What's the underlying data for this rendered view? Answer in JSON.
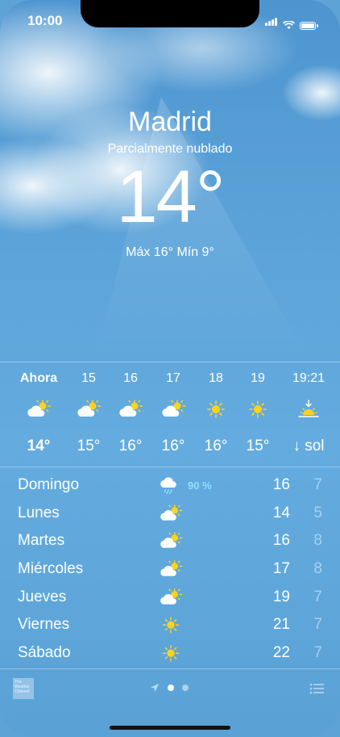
{
  "status_bar": {
    "time": "10:00"
  },
  "current": {
    "city": "Madrid",
    "condition": "Parcialmente nublado",
    "temperature": "14°",
    "hilo": "Máx 16°  Mín 9°"
  },
  "hourly": [
    {
      "label": "Ahora",
      "icon": "partly-cloudy-icon",
      "temp": "14°"
    },
    {
      "label": "15",
      "icon": "partly-cloudy-icon",
      "temp": "15°"
    },
    {
      "label": "16",
      "icon": "partly-cloudy-icon",
      "temp": "16°"
    },
    {
      "label": "17",
      "icon": "partly-cloudy-icon",
      "temp": "16°"
    },
    {
      "label": "18",
      "icon": "sun-icon",
      "temp": "16°"
    },
    {
      "label": "19",
      "icon": "sun-icon",
      "temp": "15°"
    },
    {
      "label": "19:21",
      "icon": "sunset-icon",
      "temp": "↓ sol"
    }
  ],
  "daily": [
    {
      "day": "Domingo",
      "icon": "rain-cloud-icon",
      "precip": "90 %",
      "high": "16",
      "low": "7"
    },
    {
      "day": "Lunes",
      "icon": "partly-cloudy-icon",
      "precip": "",
      "high": "14",
      "low": "5"
    },
    {
      "day": "Martes",
      "icon": "partly-cloudy-icon",
      "precip": "",
      "high": "16",
      "low": "8"
    },
    {
      "day": "Miércoles",
      "icon": "partly-cloudy-icon",
      "precip": "",
      "high": "17",
      "low": "8"
    },
    {
      "day": "Jueves",
      "icon": "partly-cloudy-icon",
      "precip": "",
      "high": "19",
      "low": "7"
    },
    {
      "day": "Viernes",
      "icon": "sun-icon",
      "precip": "",
      "high": "21",
      "low": "7"
    },
    {
      "day": "Sábado",
      "icon": "sun-icon",
      "precip": "",
      "high": "22",
      "low": "7"
    }
  ],
  "footer": {
    "logo_text": "The Weather Channel",
    "page_count": 2,
    "active_page": 0
  },
  "colors": {
    "sky": "#5aa2d8",
    "sun": "#ffd21f",
    "precip": "#8ee0ff"
  }
}
